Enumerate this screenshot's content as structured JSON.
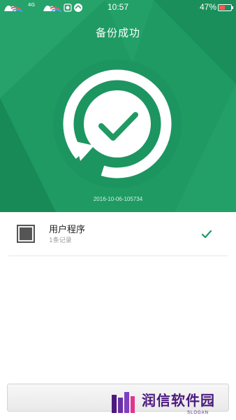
{
  "status_bar": {
    "signal_label": "4G",
    "time": "10:57",
    "battery_percent": "47%",
    "battery_level": 0.47,
    "battery_color": "#ff5a4f"
  },
  "header": {
    "title": "备份成功"
  },
  "status": {
    "icon": "backup-success-check-icon",
    "timestamp": "2016-10-06-105734"
  },
  "backup_items": [
    {
      "icon": "app-grid-icon",
      "title": "用户程序",
      "subtitle": "1条记录",
      "status_icon": "checkmark-icon"
    }
  ],
  "watermark": {
    "text": "润信软件园",
    "slogan": "SLOGAN"
  },
  "colors": {
    "hero_green": "#1f9a63",
    "check_green": "#1f9a63",
    "watermark_purple": "#4b1a7d"
  }
}
